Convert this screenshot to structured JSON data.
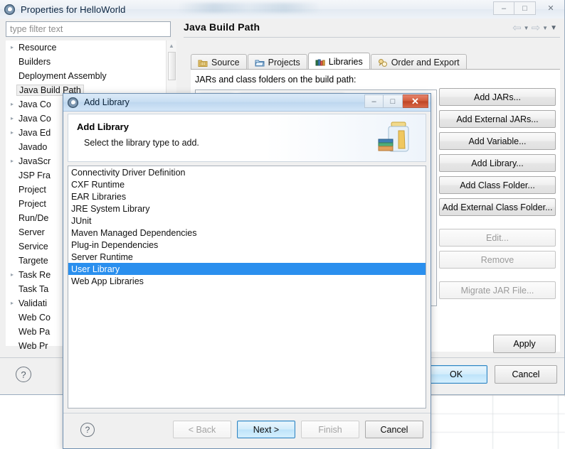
{
  "properties_window": {
    "title": "Properties for HelloWorld",
    "title_icon": "eclipse-gear-icon",
    "window_buttons": [
      {
        "name": "minimize-button",
        "glyph": "–"
      },
      {
        "name": "maximize-button",
        "glyph": "□"
      },
      {
        "name": "close-button",
        "glyph": "✕"
      }
    ],
    "filter": {
      "placeholder": "type filter text",
      "value": ""
    },
    "tree_items": [
      {
        "label": "Resource",
        "expandable": true,
        "selected": false
      },
      {
        "label": "Builders",
        "expandable": false,
        "selected": false
      },
      {
        "label": "Deployment Assembly",
        "expandable": false,
        "selected": false
      },
      {
        "label": "Java Build Path",
        "expandable": false,
        "selected": true
      },
      {
        "label": "Java Co",
        "expandable": true,
        "selected": false
      },
      {
        "label": "Java Co",
        "expandable": true,
        "selected": false
      },
      {
        "label": "Java Ed",
        "expandable": true,
        "selected": false
      },
      {
        "label": "Javado",
        "expandable": false,
        "selected": false
      },
      {
        "label": "JavaScr",
        "expandable": true,
        "selected": false
      },
      {
        "label": "JSP Fra",
        "expandable": false,
        "selected": false
      },
      {
        "label": "Project",
        "expandable": false,
        "selected": false
      },
      {
        "label": "Project",
        "expandable": false,
        "selected": false
      },
      {
        "label": "Run/De",
        "expandable": false,
        "selected": false
      },
      {
        "label": "Server",
        "expandable": false,
        "selected": false
      },
      {
        "label": "Service",
        "expandable": false,
        "selected": false
      },
      {
        "label": "Targete",
        "expandable": false,
        "selected": false
      },
      {
        "label": "Task Re",
        "expandable": true,
        "selected": false
      },
      {
        "label": "Task Ta",
        "expandable": false,
        "selected": false
      },
      {
        "label": "Validati",
        "expandable": true,
        "selected": false
      },
      {
        "label": "Web Co",
        "expandable": false,
        "selected": false
      },
      {
        "label": "Web Pa",
        "expandable": false,
        "selected": false
      },
      {
        "label": "Web Pr",
        "expandable": false,
        "selected": false
      }
    ],
    "page_title": "Java Build Path",
    "nav": {
      "back_icon": "arrow-left-icon",
      "back_caret_icon": "chevron-down-icon",
      "forward_icon": "arrow-right-icon",
      "forward_caret_icon": "chevron-down-icon",
      "menu_caret_icon": "chevron-down-icon"
    },
    "tabs": [
      {
        "label": "Source",
        "icon": "source-folder-icon",
        "active": false
      },
      {
        "label": "Projects",
        "icon": "projects-folder-icon",
        "active": false
      },
      {
        "label": "Libraries",
        "icon": "libraries-books-icon",
        "active": true
      },
      {
        "label": "Order and Export",
        "icon": "order-export-icon",
        "active": false
      }
    ],
    "tab_body_label": "JARs and class folders on the build path:",
    "side_buttons": [
      {
        "label": "Add JARs...",
        "mnemonic": "J",
        "disabled": false
      },
      {
        "label": "Add External JARs...",
        "mnemonic": "x",
        "disabled": false
      },
      {
        "label": "Add Variable...",
        "mnemonic": "V",
        "disabled": false
      },
      {
        "label": "Add Library...",
        "mnemonic": "i",
        "disabled": false
      },
      {
        "label": "Add Class Folder...",
        "mnemonic": "C",
        "disabled": false
      },
      {
        "label": "Add External Class Folder...",
        "mnemonic": "d",
        "disabled": false
      },
      {
        "label": "Edit...",
        "mnemonic": "E",
        "disabled": true
      },
      {
        "label": "Remove",
        "mnemonic": "R",
        "disabled": true
      },
      {
        "label": "Migrate JAR File...",
        "mnemonic": "M",
        "disabled": true
      }
    ],
    "apply_label": "Apply",
    "help_icon": "question-mark-icon",
    "ok_label": "OK",
    "cancel_label": "Cancel"
  },
  "add_library_dialog": {
    "title": "Add Library",
    "title_icon": "eclipse-gear-icon",
    "window_buttons": [
      {
        "name": "minimize-button",
        "glyph": "–"
      },
      {
        "name": "maximize-button",
        "glyph": "□"
      },
      {
        "name": "close-button",
        "glyph": "✕"
      }
    ],
    "heading": "Add Library",
    "subtitle": "Select the library type to add.",
    "banner_icon": "jar-with-books-icon",
    "library_types": [
      {
        "label": "Connectivity Driver Definition",
        "selected": false
      },
      {
        "label": "CXF Runtime",
        "selected": false
      },
      {
        "label": "EAR Libraries",
        "selected": false
      },
      {
        "label": "JRE System Library",
        "selected": false
      },
      {
        "label": "JUnit",
        "selected": false
      },
      {
        "label": "Maven Managed Dependencies",
        "selected": false
      },
      {
        "label": "Plug-in Dependencies",
        "selected": false
      },
      {
        "label": "Server Runtime",
        "selected": false
      },
      {
        "label": "User Library",
        "selected": true
      },
      {
        "label": "Web App Libraries",
        "selected": false
      }
    ],
    "help_icon": "question-mark-icon",
    "buttons": [
      {
        "label": "< Back",
        "name": "back-button",
        "disabled": true,
        "default": false
      },
      {
        "label": "Next >",
        "name": "next-button",
        "disabled": false,
        "default": true
      },
      {
        "label": "Finish",
        "name": "finish-button",
        "disabled": true,
        "default": false
      },
      {
        "label": "Cancel",
        "name": "cancel-button",
        "disabled": false,
        "default": false
      }
    ]
  },
  "colors": {
    "selection_blue": "#2a8fee",
    "default_button_blue": "#2e85c3",
    "close_button_red": "#cf5a38",
    "dialog_chrome": "#f0f0f0"
  }
}
